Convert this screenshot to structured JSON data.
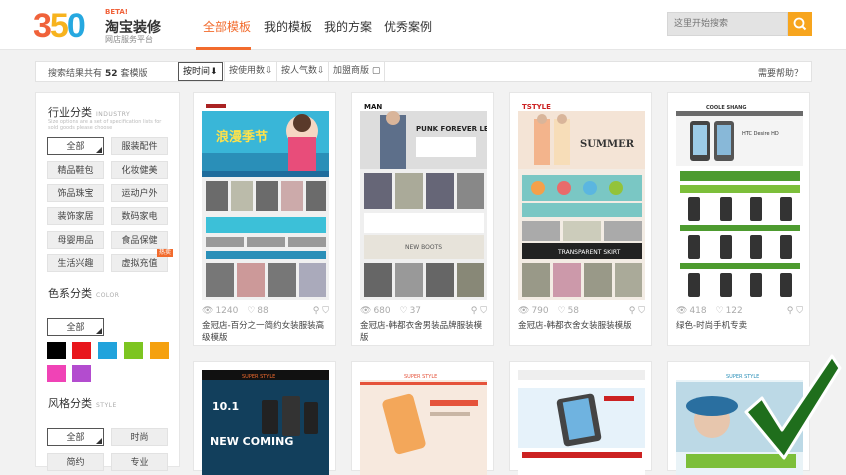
{
  "header": {
    "logo_num": [
      "3",
      "5",
      "0"
    ],
    "beta": "BETA!",
    "brand": "淘宝装修",
    "brand_sub": "网店服务平台",
    "nav": [
      "全部模板",
      "我的模板",
      "我的方案",
      "优秀案例"
    ],
    "search_placeholder": "这里开始搜索"
  },
  "filterbar": {
    "count_prefix": "搜索结果共有",
    "count": "52",
    "count_suffix": "套模版",
    "sorts": [
      "按时间⬇",
      "按使用数⇩",
      "按人气数⇩",
      "加盟商版 ▢"
    ],
    "help": "需要帮助？"
  },
  "sidebar": {
    "industry_title": "行业分类",
    "industry_en": "INDUSTRY",
    "industry_desc": "Size options are a set of specification lists for sold goods please choose",
    "industry_tags": [
      "全部",
      "服装配件",
      "精品鞋包",
      "化妆健美",
      "饰品珠宝",
      "运动户外",
      "装饰家居",
      "数码家电",
      "母婴用品",
      "食品保健",
      "生活兴趣",
      "虚拟充值"
    ],
    "hot": "热卖",
    "color_title": "色系分类",
    "color_en": "COLOR",
    "color_all": "全部",
    "colors": [
      "#000000",
      "#e8161c",
      "#21a3dc",
      "#7dc521",
      "#f5a10f",
      "#f043b6",
      "#b34ccf"
    ],
    "style_title": "风格分类",
    "style_en": "STYLE",
    "style_tags": [
      "全部",
      "时尚",
      "简约",
      "专业"
    ]
  },
  "cards": [
    {
      "views": "1240",
      "likes": "88",
      "title": "金冠店-百分之一简约女装服装高级模版"
    },
    {
      "views": "680",
      "likes": "37",
      "title": "金冠店-韩都衣舍男装品牌服装模版"
    },
    {
      "views": "790",
      "likes": "58",
      "title": "金冠店-韩都衣舍女装服装模版"
    },
    {
      "views": "418",
      "likes": "122",
      "title": "绿色-时尚手机专卖"
    }
  ],
  "thumbs": {
    "t1_banner": "浪漫季节",
    "t2_brand": "MAN",
    "t2_banner": "PUNK FOREVER LETTERS",
    "t2_sub": "NEW BOOTS",
    "t3_brand": "TSTYLE",
    "t3_banner": "SUMMER",
    "t3_sub": "TRANSPARENT SKIRT",
    "t4_brand": "COOLE SHANG",
    "t4_banner": "HTC Desire HD",
    "b1_text": "NEW COMING",
    "b1_date": "10.1",
    "b1_top": "SUPER STYLE",
    "b2_top": "SUPER STYLE",
    "b4_top": "SUPER STYLE"
  },
  "icon_colors": {
    "accent": "#f26b2d",
    "search_btn": "#f7a51e",
    "check": "#1f6e1c"
  }
}
